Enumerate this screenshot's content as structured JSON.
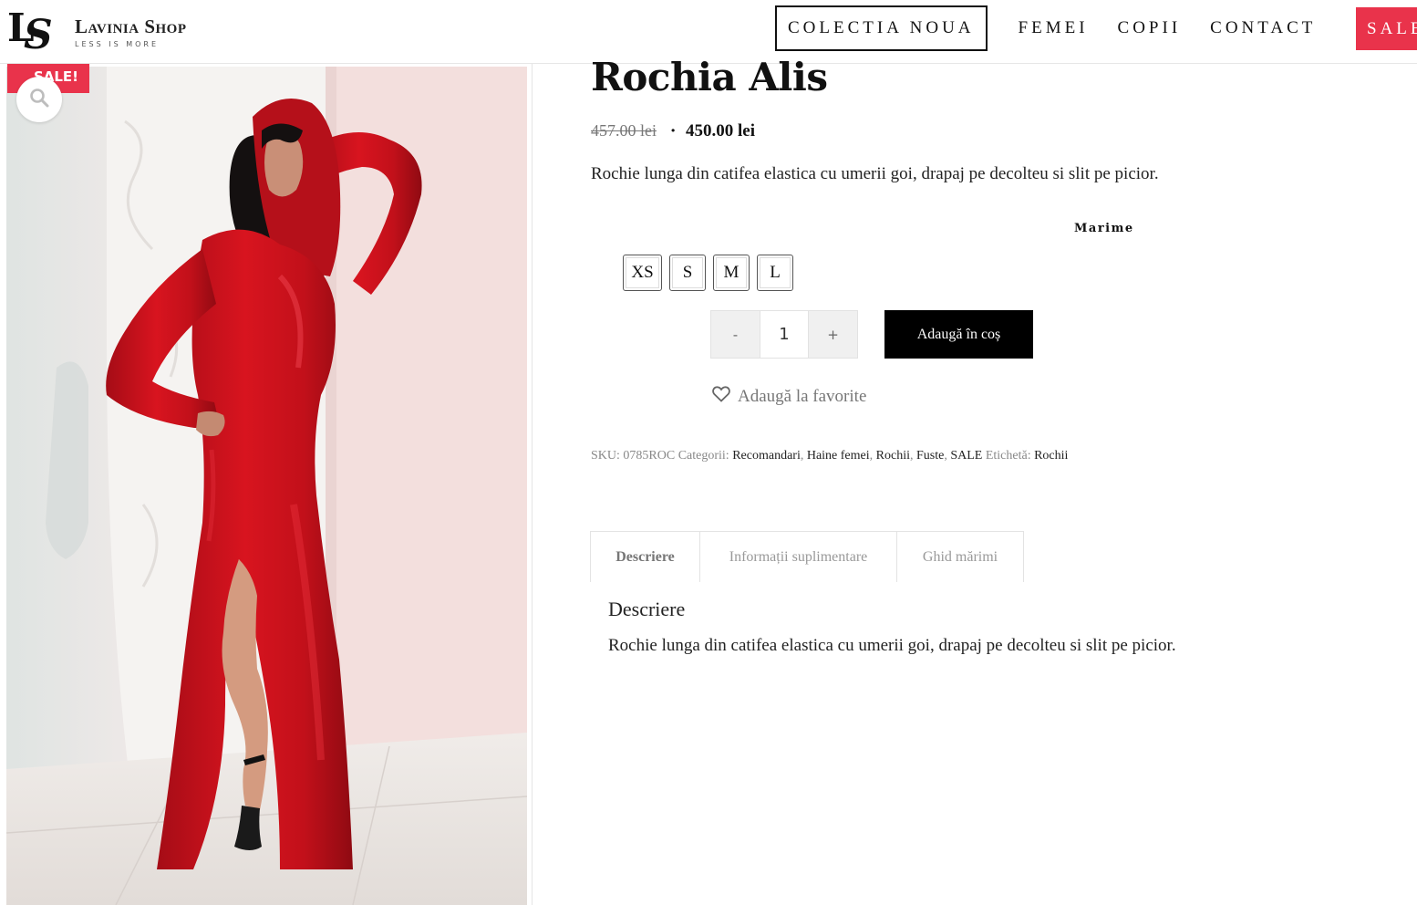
{
  "header": {
    "logo_name": "Lavinia Shop",
    "logo_tagline": "LESS IS MORE",
    "logo_mark_l": "L",
    "logo_mark_s": "S",
    "nav": [
      "COLECTIA NOUA",
      "FEMEI",
      "COPII",
      "CONTACT"
    ],
    "nav_sale": "SALE"
  },
  "gallery": {
    "sale_badge": "SALE!",
    "zoom_icon": "search-icon"
  },
  "product": {
    "title": "Rochia Alis",
    "price_old": "457.00 lei",
    "price_separator": "·",
    "price_new": "450.00 lei",
    "short_description": "Rochie lunga din catifea elastica cu umerii goi, drapaj pe decolteu si slit pe picior.",
    "size_label": "Marime",
    "sizes": [
      "XS",
      "S",
      "M",
      "L"
    ],
    "quantity": {
      "minus": "-",
      "value": "1",
      "plus": "+"
    },
    "add_to_cart": "Adaugă în coș",
    "wishlist": "Adaugă la favorite"
  },
  "meta": {
    "sku_label": "SKU:",
    "sku": "0785ROC",
    "categories_label": "Categorii:",
    "categories": [
      "Recomandari",
      "Haine femei",
      "Rochii",
      "Fuste",
      "SALE"
    ],
    "tag_label": "Etichetă:",
    "tag": "Rochii"
  },
  "tabs": {
    "items": [
      "Descriere",
      "Informații suplimentare",
      "Ghid mărimi"
    ],
    "panel_title": "Descriere",
    "panel_text": "Rochie lunga din catifea elastica cu umerii goi, drapaj pe decolteu si slit pe picior."
  },
  "colors": {
    "sale_red": "#e9334b",
    "dress_red": "#c8101c",
    "button_black": "#000000"
  }
}
